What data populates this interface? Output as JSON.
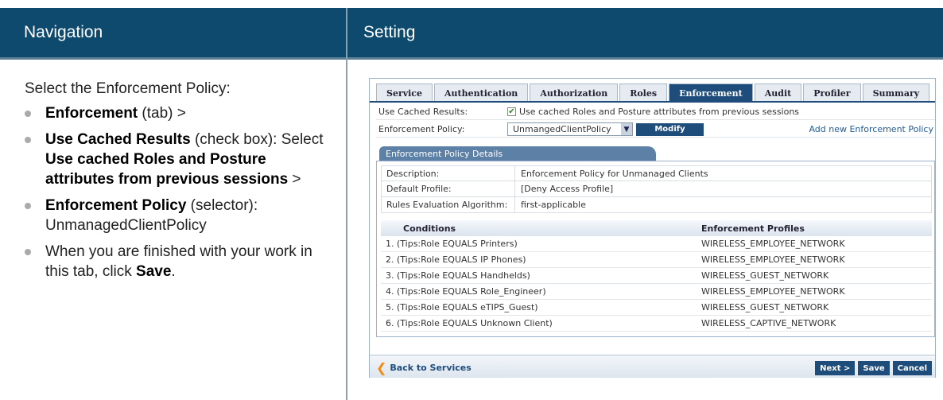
{
  "header": {
    "navigation": "Navigation",
    "setting": "Setting"
  },
  "nav": {
    "intro": "Select the Enforcement Policy:",
    "items": [
      {
        "bold": "Enforcement",
        "rest": " (tab) >"
      },
      {
        "bold": "Use Cached Results",
        "rest": " (check box): Select ",
        "bold2": "Use cached Roles and Posture attributes from previous sessions",
        "rest2": " >"
      },
      {
        "bold": "Enforcement Policy",
        "rest": " (selector): UnmanagedClientPolicy"
      },
      {
        "plain": "When you are finished with your work in this tab, click ",
        "bold": "Save",
        "rest": "."
      }
    ]
  },
  "shot": {
    "tabs": [
      "Service",
      "Authentication",
      "Authorization",
      "Roles",
      "Enforcement",
      "Audit",
      "Profiler",
      "Summary"
    ],
    "active_tab": "Enforcement",
    "cached_label": "Use Cached Results:",
    "cached_text": "Use cached Roles and Posture attributes from previous sessions",
    "policy_label": "Enforcement Policy:",
    "policy_value": "UnmangedClientPolicy",
    "modify": "Modify",
    "add_link": "Add new Enforcement Policy",
    "details_tab": "Enforcement Policy Details",
    "details": [
      {
        "label": "Description:",
        "value": "Enforcement Policy for Unmanaged Clients"
      },
      {
        "label": "Default Profile:",
        "value": "[Deny Access Profile]"
      },
      {
        "label": "Rules Evaluation Algorithm:",
        "value": "first-applicable"
      }
    ],
    "col_conditions": "Conditions",
    "col_profiles": "Enforcement Profiles",
    "rules": [
      {
        "cond": "1.  (Tips:Role EQUALS Printers)",
        "prof": "WIRELESS_EMPLOYEE_NETWORK"
      },
      {
        "cond": "2.  (Tips:Role EQUALS IP Phones)",
        "prof": "WIRELESS_EMPLOYEE_NETWORK"
      },
      {
        "cond": "3.  (Tips:Role EQUALS Handhelds)",
        "prof": "WIRELESS_GUEST_NETWORK"
      },
      {
        "cond": "4.  (Tips:Role EQUALS Role_Engineer)",
        "prof": "WIRELESS_EMPLOYEE_NETWORK"
      },
      {
        "cond": "5.  (Tips:Role EQUALS eTIPS_Guest)",
        "prof": "WIRELESS_GUEST_NETWORK"
      },
      {
        "cond": "6.  (Tips:Role EQUALS Unknown Client)",
        "prof": "WIRELESS_CAPTIVE_NETWORK"
      }
    ],
    "back": "Back to Services",
    "next": "Next >",
    "save": "Save",
    "cancel": "Cancel"
  }
}
